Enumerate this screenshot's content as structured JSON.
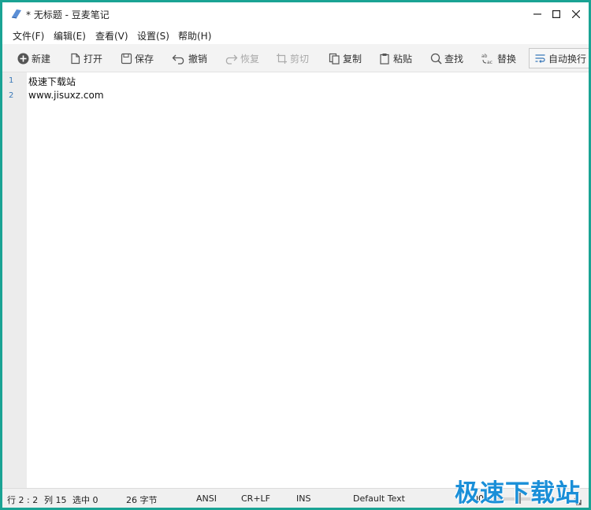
{
  "window": {
    "title": "* 无标题 - 豆麦笔记",
    "accent": "#1aa394"
  },
  "menu": [
    {
      "label": "文件(F)"
    },
    {
      "label": "编辑(E)"
    },
    {
      "label": "查看(V)"
    },
    {
      "label": "设置(S)"
    },
    {
      "label": "帮助(H)"
    }
  ],
  "toolbar": {
    "new": "新建",
    "open": "打开",
    "save": "保存",
    "undo": "撤销",
    "redo": "恢复",
    "cut": "剪切",
    "copy": "复制",
    "paste": "粘贴",
    "find": "查找",
    "replace": "替换",
    "wrap": "自动换行"
  },
  "editor": {
    "line_numbers": [
      "1",
      "2"
    ],
    "lines": [
      "极速下载站",
      "www.jisuxz.com"
    ]
  },
  "status": {
    "position": "行 2 : 2",
    "column": "列 15",
    "selection": "选中 0",
    "bytes": "26 字节",
    "encoding": "ANSI",
    "line_ending": "CR+LF",
    "insert_mode": "INS",
    "syntax": "Default Text",
    "zoom": "100%"
  },
  "watermark": "极速下载站"
}
